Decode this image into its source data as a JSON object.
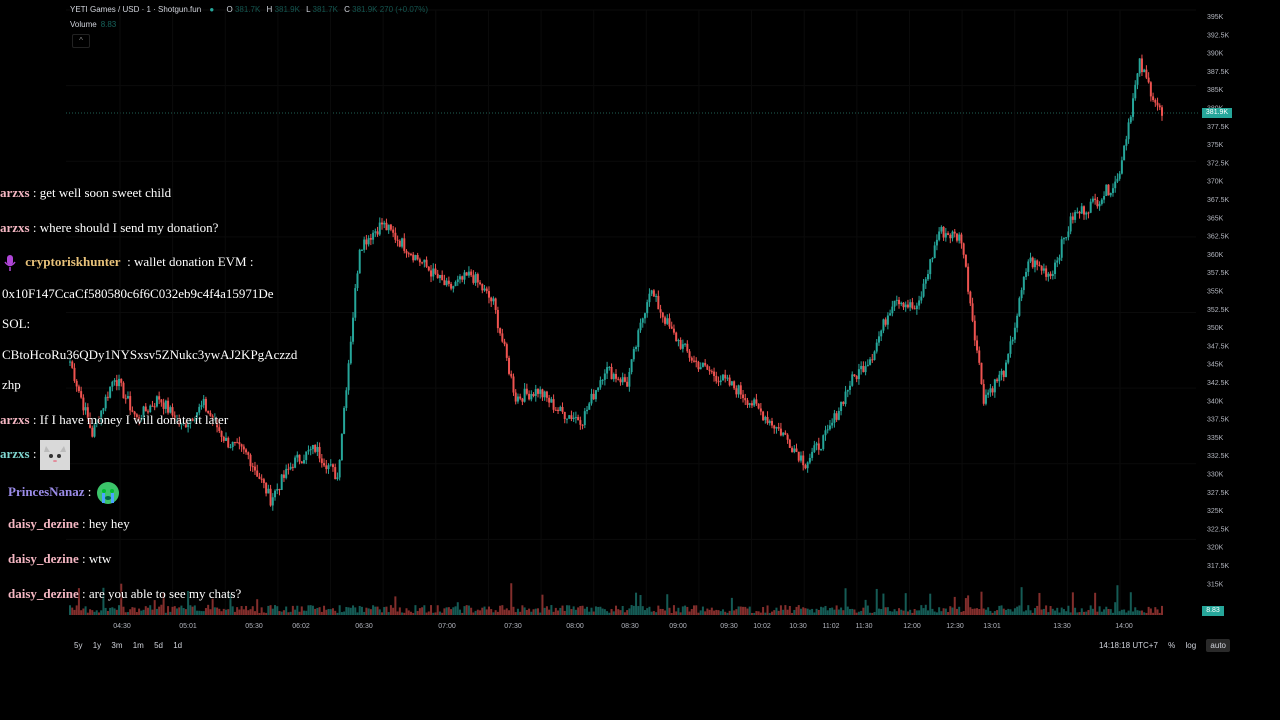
{
  "header": {
    "title": "YETI Games / USD · 1 · Shotgun.fun",
    "o_label": "O",
    "o_val": "381.7K",
    "h_label": "H",
    "h_val": "381.9K",
    "l_label": "L",
    "l_val": "381.7K",
    "c_label": "C",
    "c_val": "381.9K 270 (+0.07%)",
    "volume_label": "Volume",
    "volume_val": "8.83"
  },
  "price_axis": [
    "395K",
    "392.5K",
    "390K",
    "387.5K",
    "385K",
    "380K",
    "377.5K",
    "375K",
    "372.5K",
    "370K",
    "367.5K",
    "365K",
    "362.5K",
    "360K",
    "357.5K",
    "355K",
    "352.5K",
    "350K",
    "347.5K",
    "345K",
    "342.5K",
    "340K",
    "337.5K",
    "335K",
    "332.5K",
    "330K",
    "327.5K",
    "325K",
    "322.5K",
    "320K",
    "317.5K",
    "315K"
  ],
  "price_tag": "381.9K",
  "volume_tag": "8.83",
  "time_axis": [
    "04:30",
    "05:01",
    "05:30",
    "06:02",
    "06:30",
    "07:00",
    "07:30",
    "08:00",
    "08:30",
    "09:00",
    "09:30",
    "10:02",
    "10:30",
    "11:02",
    "11:30",
    "12:00",
    "12:30",
    "13:01",
    "13:30",
    "14:00"
  ],
  "timeframes": [
    "5y",
    "1y",
    "3m",
    "1m",
    "5d",
    "1d"
  ],
  "bottom_right": {
    "clock": "14:18:18 UTC+7",
    "pct": "%",
    "log": "log",
    "auto": "auto"
  },
  "colors": {
    "up": "#26a69a",
    "down": "#ef5350",
    "background": "#000000"
  },
  "chat": [
    {
      "user": "arzxs",
      "user_color": "#f4b6c2",
      "text": ": get well soon sweet child"
    },
    {
      "user": "arzxs",
      "user_color": "#f4b6c2",
      "text": ": where should I send my donation?"
    },
    {
      "user": "cryptoriskhunter",
      "user_color": "#e8c27a",
      "text": ": wallet donation EVM :",
      "icon": "microphone-icon"
    },
    {
      "user": "",
      "text": "0x10F147CcaCf580580c6f6C032eb9c4f4a15971De"
    },
    {
      "user": "",
      "text": "SOL:"
    },
    {
      "user": "",
      "text": "CBtoHcoRu36QDy1NYSxsv5ZNukc3ywAJ2KPgAczzd"
    },
    {
      "user": "",
      "text": "zhp"
    },
    {
      "user": "arzxs",
      "user_color": "#f4b6c2",
      "text": ": If I have money I will donate it later"
    },
    {
      "user": "arzxs",
      "user_color": "#f4b6c2",
      "text": ":",
      "icon": "cat-emote-icon"
    },
    {
      "user": "PrincesNanaz",
      "user_color": "#9b8ce8",
      "text": ":",
      "icon": "crying-emoji-icon"
    },
    {
      "user": "daisy_dezine",
      "user_color": "#f4b6c2",
      "text": ": hey hey"
    },
    {
      "user": "daisy_dezine",
      "user_color": "#f4b6c2",
      "text": ": wtw"
    },
    {
      "user": "daisy_dezine",
      "user_color": "#f4b6c2",
      "text": ": are you able to see my chats?"
    }
  ],
  "chart_data": {
    "type": "candlestick",
    "ylim": [
      313000,
      396500
    ],
    "series": [
      {
        "time": "04:20",
        "close": 348000
      },
      {
        "time": "04:30",
        "close": 338000
      },
      {
        "time": "04:45",
        "close": 346000
      },
      {
        "time": "04:55",
        "close": 340000
      },
      {
        "time": "05:01",
        "close": 343000
      },
      {
        "time": "05:10",
        "close": 339000
      },
      {
        "time": "05:20",
        "close": 342000
      },
      {
        "time": "05:30",
        "close": 337000
      },
      {
        "time": "05:45",
        "close": 335000
      },
      {
        "time": "06:02",
        "close": 329000
      },
      {
        "time": "06:10",
        "close": 334000
      },
      {
        "time": "06:20",
        "close": 336000
      },
      {
        "time": "06:30",
        "close": 332000
      },
      {
        "time": "06:35",
        "close": 364000
      },
      {
        "time": "06:45",
        "close": 367000
      },
      {
        "time": "07:00",
        "close": 364000
      },
      {
        "time": "07:15",
        "close": 361000
      },
      {
        "time": "07:30",
        "close": 358000
      },
      {
        "time": "07:45",
        "close": 360000
      },
      {
        "time": "08:00",
        "close": 356000
      },
      {
        "time": "08:15",
        "close": 343000
      },
      {
        "time": "08:30",
        "close": 344000
      },
      {
        "time": "08:45",
        "close": 341000
      },
      {
        "time": "09:00",
        "close": 340000
      },
      {
        "time": "09:10",
        "close": 347000
      },
      {
        "time": "09:20",
        "close": 345000
      },
      {
        "time": "09:30",
        "close": 358000
      },
      {
        "time": "09:45",
        "close": 352000
      },
      {
        "time": "10:02",
        "close": 348000
      },
      {
        "time": "10:15",
        "close": 346000
      },
      {
        "time": "10:30",
        "close": 344000
      },
      {
        "time": "10:45",
        "close": 341000
      },
      {
        "time": "11:02",
        "close": 338000
      },
      {
        "time": "11:15",
        "close": 334000
      },
      {
        "time": "11:30",
        "close": 338000
      },
      {
        "time": "11:45",
        "close": 345000
      },
      {
        "time": "12:00",
        "close": 349000
      },
      {
        "time": "12:15",
        "close": 357000
      },
      {
        "time": "12:30",
        "close": 355000
      },
      {
        "time": "12:45",
        "close": 366000
      },
      {
        "time": "13:01",
        "close": 365000
      },
      {
        "time": "13:05",
        "close": 343000
      },
      {
        "time": "13:15",
        "close": 347000
      },
      {
        "time": "13:30",
        "close": 362000
      },
      {
        "time": "13:45",
        "close": 360000
      },
      {
        "time": "13:55",
        "close": 368000
      },
      {
        "time": "14:00",
        "close": 370000
      },
      {
        "time": "14:08",
        "close": 373000
      },
      {
        "time": "14:12",
        "close": 389000
      },
      {
        "time": "14:18",
        "close": 381900
      }
    ]
  }
}
